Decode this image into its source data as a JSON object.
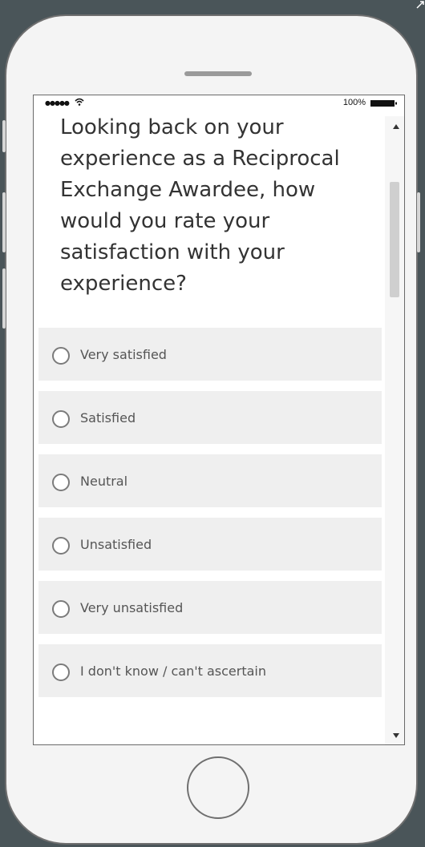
{
  "status_bar": {
    "signal": "●●●●●",
    "battery_percent": "100%"
  },
  "question": {
    "text": "Looking back on your experience as a Reciprocal Exchange Awardee, how would you rate your satisfaction with your experience?"
  },
  "options": [
    {
      "label": "Very satisfied"
    },
    {
      "label": "Satisfied"
    },
    {
      "label": "Neutral"
    },
    {
      "label": "Unsatisfied"
    },
    {
      "label": "Very unsatisfied"
    },
    {
      "label": "I don't know / can't ascertain"
    }
  ],
  "colors": {
    "background": "#4a5559",
    "phone_body": "#f4f4f4",
    "option_bg": "#efefef",
    "text": "#333333"
  }
}
